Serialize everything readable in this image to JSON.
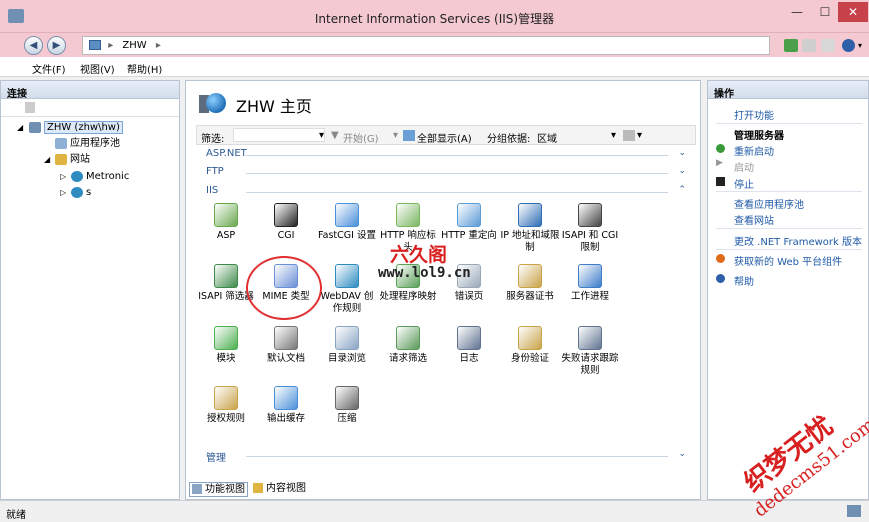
{
  "window": {
    "title": "Internet Information Services (IIS)管理器"
  },
  "address": {
    "path": "ZHW",
    "sep1": "▸",
    "sep2": "▸"
  },
  "menu": [
    "文件(F)",
    "视图(V)",
    "帮助(H)"
  ],
  "connections": {
    "header": "连接",
    "tree": {
      "server": "ZHW (zhw\\hw)",
      "app_pools": "应用程序池",
      "sites": "网站",
      "site1": "Metronic",
      "site2": "s"
    }
  },
  "center": {
    "title": "ZHW 主页",
    "filter": {
      "label": "筛选:",
      "start": "开始(G)",
      "show_all": "全部显示(A)",
      "group_by_label": "分组依据:",
      "group_by_value": "区域"
    },
    "groups": [
      "ASP.NET",
      "FTP",
      "IIS",
      "管理"
    ],
    "features": [
      {
        "label": "ASP",
        "icon": "asp-icon",
        "color": "#6aa84f"
      },
      {
        "label": "CGI",
        "icon": "cgi-icon",
        "color": "#222222"
      },
      {
        "label": "FastCGI 设置",
        "icon": "fastcgi-icon",
        "color": "#4a90d9"
      },
      {
        "label": "HTTP 响应标头",
        "icon": "http-headers-icon",
        "color": "#7bb661"
      },
      {
        "label": "HTTP 重定向",
        "icon": "http-redirect-icon",
        "color": "#5c9bd6"
      },
      {
        "label": "IP 地址和域限制",
        "icon": "ip-restrict-icon",
        "color": "#2e6db4"
      },
      {
        "label": "ISAPI 和 CGI 限制",
        "icon": "isapi-cgi-icon",
        "color": "#444444"
      },
      {
        "label": "ISAPI 筛选器",
        "icon": "isapi-filter-icon",
        "color": "#3d8a4a"
      },
      {
        "label": "MIME 类型",
        "icon": "mime-icon",
        "color": "#6a8fd6"
      },
      {
        "label": "WebDAV 创作规则",
        "icon": "webdav-icon",
        "color": "#2e8bc0"
      },
      {
        "label": "处理程序映射",
        "icon": "handler-icon",
        "color": "#5aa05a"
      },
      {
        "label": "错误页",
        "icon": "error-page-icon",
        "color": "#9aa8b8"
      },
      {
        "label": "服务器证书",
        "icon": "cert-icon",
        "color": "#c9a34a"
      },
      {
        "label": "工作进程",
        "icon": "worker-icon",
        "color": "#3d7cc9"
      },
      {
        "label": "模块",
        "icon": "modules-icon",
        "color": "#4caf50"
      },
      {
        "label": "默认文档",
        "icon": "default-doc-icon",
        "color": "#777777"
      },
      {
        "label": "目录浏览",
        "icon": "dir-browse-icon",
        "color": "#8aa4c4"
      },
      {
        "label": "请求筛选",
        "icon": "request-filter-icon",
        "color": "#5a9a5a"
      },
      {
        "label": "日志",
        "icon": "log-icon",
        "color": "#5f7391"
      },
      {
        "label": "身份验证",
        "icon": "auth-icon",
        "color": "#c9a34a"
      },
      {
        "label": "失败请求跟踪规则",
        "icon": "failed-trace-icon",
        "color": "#5f7391"
      },
      {
        "label": "授权规则",
        "icon": "authz-icon",
        "color": "#c9a34a"
      },
      {
        "label": "输出缓存",
        "icon": "output-cache-icon",
        "color": "#4a90d9"
      },
      {
        "label": "压缩",
        "icon": "compress-icon",
        "color": "#666666"
      }
    ],
    "view_tabs": [
      "功能视图",
      "内容视图"
    ]
  },
  "actions": {
    "header": "操作",
    "open_feature": "打开功能",
    "manage_server": "管理服务器",
    "restart": "重新启动",
    "start": "启动",
    "stop": "停止",
    "view_app_pools": "查看应用程序池",
    "view_sites": "查看网站",
    "change_net": "更改 .NET Framework 版本",
    "get_web_platform": "获取新的 Web 平台组件",
    "help": "帮助"
  },
  "status": {
    "text": "就绪"
  },
  "watermark": {
    "w1": "六久阁",
    "w2": "www.lol9.cn",
    "w3": "织梦无忧",
    "w4": "dedecms51.com"
  }
}
